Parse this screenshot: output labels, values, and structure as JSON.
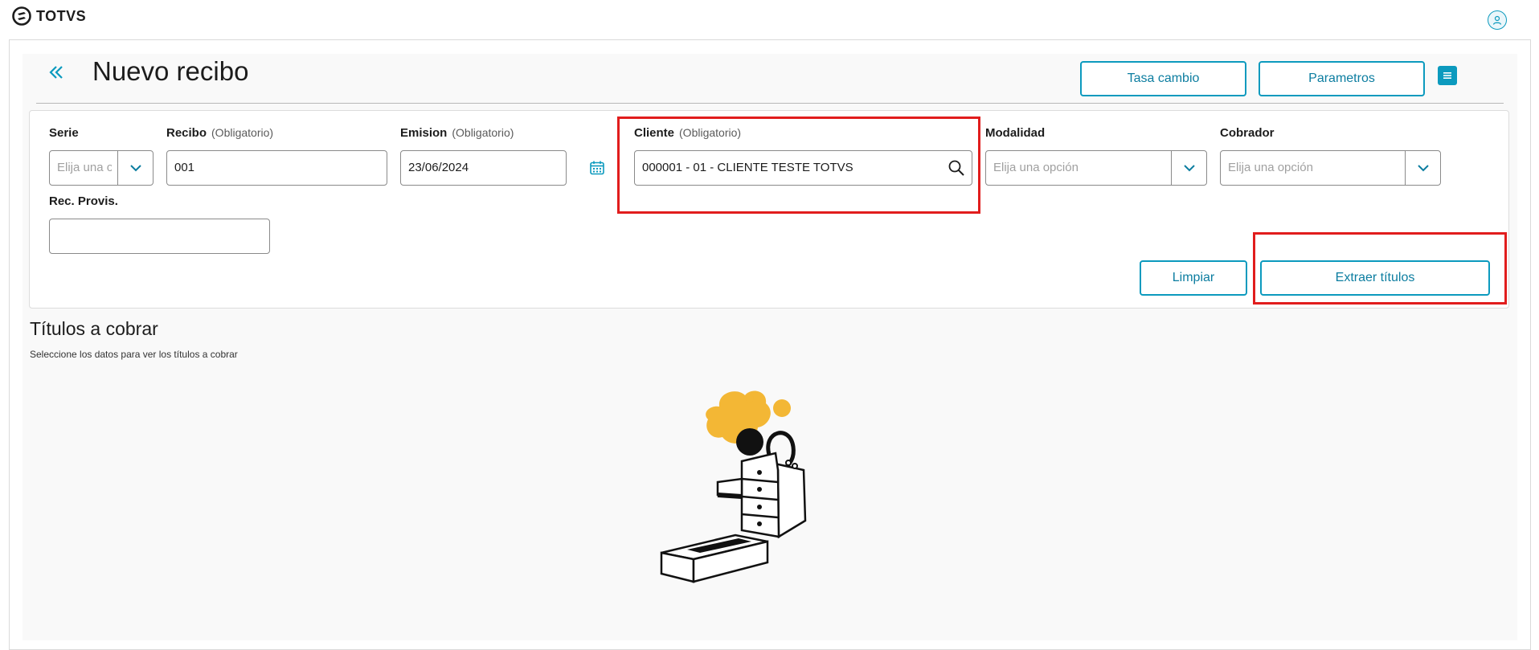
{
  "app": {
    "logo_text": "TOTVS",
    "user_icon": "user-icon"
  },
  "header": {
    "title": "Nuevo recibo",
    "back_icon": "double-chevron-left-icon",
    "tasa_label": "Tasa cambio",
    "parametros_label": "Parametros",
    "menu_icon": "menu-icon"
  },
  "form": {
    "serie": {
      "label": "Serie",
      "placeholder": "Elija una o"
    },
    "recibo": {
      "label": "Recibo",
      "hint": "(Obligatorio)",
      "value": "001"
    },
    "emision": {
      "label": "Emision",
      "hint": "(Obligatorio)",
      "value": "23/06/2024"
    },
    "cliente": {
      "label": "Cliente",
      "hint": "(Obligatorio)",
      "value": "000001 - 01 - CLIENTE TESTE TOTVS"
    },
    "modalidad": {
      "label": "Modalidad",
      "placeholder": "Elija una opción"
    },
    "cobrador": {
      "label": "Cobrador",
      "placeholder": "Elija una opción"
    },
    "rec_provis": {
      "label": "Rec. Provis.",
      "value": ""
    },
    "limpiar_label": "Limpiar",
    "extraer_label": "Extraer títulos"
  },
  "section": {
    "title": "Títulos a cobrar",
    "subtitle": "Seleccione los datos para ver los títulos a cobrar"
  },
  "colors": {
    "accent": "#0c9abe",
    "highlight": "#e11d1d",
    "illustration_yellow": "#f3b735"
  }
}
